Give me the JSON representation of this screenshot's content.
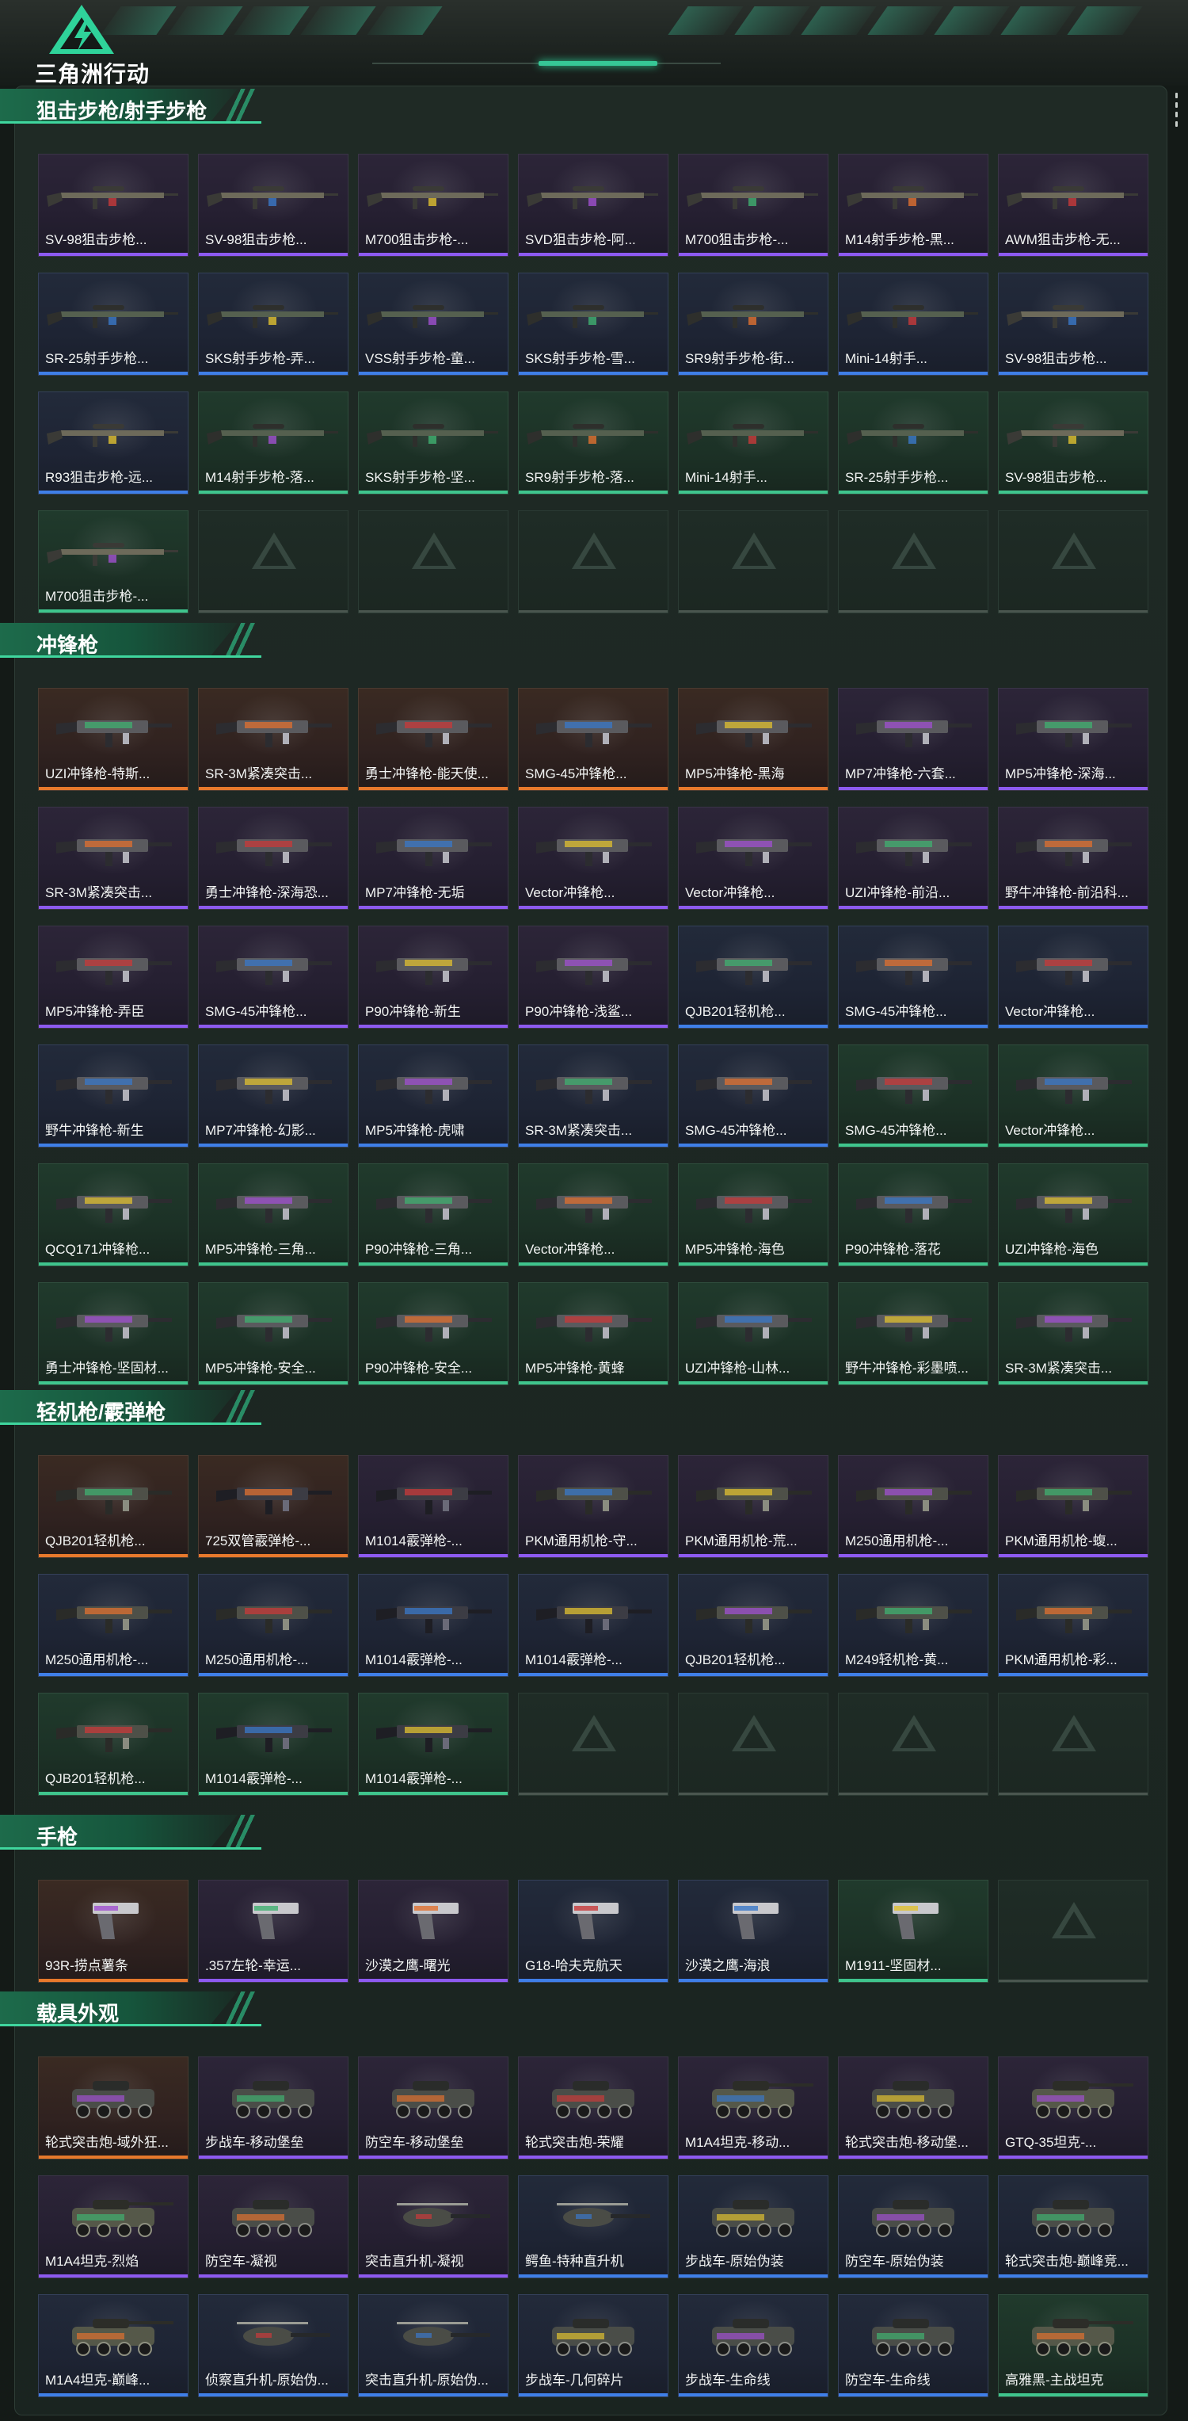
{
  "app": {
    "logo_text": "三角洲行动"
  },
  "colors": {
    "accent": "#3fd69e",
    "rarity_purple": "#8d5af0",
    "rarity_orange": "#e8792c",
    "rarity_blue": "#3f7fe8",
    "rarity_green": "#3fc58d"
  },
  "sections": [
    {
      "title": "狙击步枪/射手步枪",
      "items": [
        {
          "name": "SV-98狙击步枪...",
          "rarity": "purple",
          "kind": "sniper"
        },
        {
          "name": "SV-98狙击步枪...",
          "rarity": "purple",
          "kind": "sniper"
        },
        {
          "name": "M700狙击步枪-...",
          "rarity": "purple",
          "kind": "sniper"
        },
        {
          "name": "SVD狙击步枪-阿...",
          "rarity": "purple",
          "kind": "sniper"
        },
        {
          "name": "M700狙击步枪-...",
          "rarity": "purple",
          "kind": "sniper"
        },
        {
          "name": "M14射手步枪-黑...",
          "rarity": "purple",
          "kind": "sniper"
        },
        {
          "name": "AWM狙击步枪-无...",
          "rarity": "purple",
          "kind": "sniper"
        },
        {
          "name": "SR-25射手步枪...",
          "rarity": "blue",
          "kind": "rifle"
        },
        {
          "name": "SKS射手步枪-弄...",
          "rarity": "blue",
          "kind": "rifle"
        },
        {
          "name": "VSS射手步枪-童...",
          "rarity": "blue",
          "kind": "rifle"
        },
        {
          "name": "SKS射手步枪-雪...",
          "rarity": "blue",
          "kind": "rifle"
        },
        {
          "name": "SR9射手步枪-街...",
          "rarity": "blue",
          "kind": "rifle"
        },
        {
          "name": "Mini-14射手...",
          "rarity": "blue",
          "kind": "rifle"
        },
        {
          "name": "SV-98狙击步枪...",
          "rarity": "blue",
          "kind": "sniper"
        },
        {
          "name": "R93狙击步枪-远...",
          "rarity": "blue",
          "kind": "sniper"
        },
        {
          "name": "M14射手步枪-落...",
          "rarity": "green",
          "kind": "rifle"
        },
        {
          "name": "SKS射手步枪-坚...",
          "rarity": "green",
          "kind": "rifle"
        },
        {
          "name": "SR9射手步枪-落...",
          "rarity": "green",
          "kind": "rifle"
        },
        {
          "name": "Mini-14射手...",
          "rarity": "green",
          "kind": "rifle"
        },
        {
          "name": "SR-25射手步枪...",
          "rarity": "green",
          "kind": "rifle"
        },
        {
          "name": "SV-98狙击步枪...",
          "rarity": "green",
          "kind": "sniper"
        },
        {
          "name": "M700狙击步枪-...",
          "rarity": "green",
          "kind": "sniper"
        },
        {
          "name": "",
          "rarity": "empty"
        },
        {
          "name": "",
          "rarity": "empty"
        },
        {
          "name": "",
          "rarity": "empty"
        },
        {
          "name": "",
          "rarity": "empty"
        },
        {
          "name": "",
          "rarity": "empty"
        },
        {
          "name": "",
          "rarity": "empty"
        }
      ]
    },
    {
      "title": "冲锋枪",
      "items": [
        {
          "name": "UZI冲锋枪-特斯...",
          "rarity": "orange",
          "kind": "smg"
        },
        {
          "name": "SR-3M紧凑突击...",
          "rarity": "orange",
          "kind": "smg"
        },
        {
          "name": "勇士冲锋枪-能天使...",
          "rarity": "orange",
          "kind": "smg"
        },
        {
          "name": "SMG-45冲锋枪...",
          "rarity": "orange",
          "kind": "smg"
        },
        {
          "name": "MP5冲锋枪-黑海",
          "rarity": "orange",
          "kind": "smg"
        },
        {
          "name": "MP7冲锋枪-六套...",
          "rarity": "purple",
          "kind": "smg"
        },
        {
          "name": "MP5冲锋枪-深海...",
          "rarity": "purple",
          "kind": "smg"
        },
        {
          "name": "SR-3M紧凑突击...",
          "rarity": "purple",
          "kind": "smg"
        },
        {
          "name": "勇士冲锋枪-深海恐...",
          "rarity": "purple",
          "kind": "smg"
        },
        {
          "name": "MP7冲锋枪-无垢",
          "rarity": "purple",
          "kind": "smg"
        },
        {
          "name": "Vector冲锋枪...",
          "rarity": "purple",
          "kind": "smg"
        },
        {
          "name": "Vector冲锋枪...",
          "rarity": "purple",
          "kind": "smg"
        },
        {
          "name": "UZI冲锋枪-前沿...",
          "rarity": "purple",
          "kind": "smg"
        },
        {
          "name": "野牛冲锋枪-前沿科...",
          "rarity": "purple",
          "kind": "smg"
        },
        {
          "name": "MP5冲锋枪-弄臣",
          "rarity": "purple",
          "kind": "smg"
        },
        {
          "name": "SMG-45冲锋枪...",
          "rarity": "purple",
          "kind": "smg"
        },
        {
          "name": "P90冲锋枪-新生",
          "rarity": "purple",
          "kind": "smg"
        },
        {
          "name": "P90冲锋枪-浅鲨...",
          "rarity": "purple",
          "kind": "smg"
        },
        {
          "name": "QJB201轻机枪...",
          "rarity": "blue",
          "kind": "smg"
        },
        {
          "name": "SMG-45冲锋枪...",
          "rarity": "blue",
          "kind": "smg"
        },
        {
          "name": "Vector冲锋枪...",
          "rarity": "blue",
          "kind": "smg"
        },
        {
          "name": "野牛冲锋枪-新生",
          "rarity": "blue",
          "kind": "smg"
        },
        {
          "name": "MP7冲锋枪-幻影...",
          "rarity": "blue",
          "kind": "smg"
        },
        {
          "name": "MP5冲锋枪-虎啸",
          "rarity": "blue",
          "kind": "smg"
        },
        {
          "name": "SR-3M紧凑突击...",
          "rarity": "blue",
          "kind": "smg"
        },
        {
          "name": "SMG-45冲锋枪...",
          "rarity": "blue",
          "kind": "smg"
        },
        {
          "name": "SMG-45冲锋枪...",
          "rarity": "green",
          "kind": "smg"
        },
        {
          "name": "Vector冲锋枪...",
          "rarity": "green",
          "kind": "smg"
        },
        {
          "name": "QCQ171冲锋枪...",
          "rarity": "green",
          "kind": "smg"
        },
        {
          "name": "MP5冲锋枪-三角...",
          "rarity": "green",
          "kind": "smg"
        },
        {
          "name": "P90冲锋枪-三角...",
          "rarity": "green",
          "kind": "smg"
        },
        {
          "name": "Vector冲锋枪...",
          "rarity": "green",
          "kind": "smg"
        },
        {
          "name": "MP5冲锋枪-海色",
          "rarity": "green",
          "kind": "smg"
        },
        {
          "name": "P90冲锋枪-落花",
          "rarity": "green",
          "kind": "smg"
        },
        {
          "name": "UZI冲锋枪-海色",
          "rarity": "green",
          "kind": "smg"
        },
        {
          "name": "勇士冲锋枪-坚固材...",
          "rarity": "green",
          "kind": "smg"
        },
        {
          "name": "MP5冲锋枪-安全...",
          "rarity": "green",
          "kind": "smg"
        },
        {
          "name": "P90冲锋枪-安全...",
          "rarity": "green",
          "kind": "smg"
        },
        {
          "name": "MP5冲锋枪-黄蜂",
          "rarity": "green",
          "kind": "smg"
        },
        {
          "name": "UZI冲锋枪-山林...",
          "rarity": "green",
          "kind": "smg"
        },
        {
          "name": "野牛冲锋枪-彩墨喷...",
          "rarity": "green",
          "kind": "smg"
        },
        {
          "name": "SR-3M紧凑突击...",
          "rarity": "green",
          "kind": "smg"
        }
      ]
    },
    {
      "title": "轻机枪/霰弹枪",
      "items": [
        {
          "name": "QJB201轻机枪...",
          "rarity": "orange",
          "kind": "lmg"
        },
        {
          "name": "725双管霰弹枪-...",
          "rarity": "orange",
          "kind": "shotgun"
        },
        {
          "name": "M1014霰弹枪-...",
          "rarity": "purple",
          "kind": "shotgun"
        },
        {
          "name": "PKM通用机枪-守...",
          "rarity": "purple",
          "kind": "lmg"
        },
        {
          "name": "PKM通用机枪-荒...",
          "rarity": "purple",
          "kind": "lmg"
        },
        {
          "name": "M250通用机枪-...",
          "rarity": "purple",
          "kind": "lmg"
        },
        {
          "name": "PKM通用机枪-蝮...",
          "rarity": "purple",
          "kind": "lmg"
        },
        {
          "name": "M250通用机枪-...",
          "rarity": "blue",
          "kind": "lmg"
        },
        {
          "name": "M250通用机枪-...",
          "rarity": "blue",
          "kind": "lmg"
        },
        {
          "name": "M1014霰弹枪-...",
          "rarity": "blue",
          "kind": "shotgun"
        },
        {
          "name": "M1014霰弹枪-...",
          "rarity": "blue",
          "kind": "shotgun"
        },
        {
          "name": "QJB201轻机枪...",
          "rarity": "blue",
          "kind": "lmg"
        },
        {
          "name": "M249轻机枪-黄...",
          "rarity": "blue",
          "kind": "lmg"
        },
        {
          "name": "PKM通用机枪-彩...",
          "rarity": "blue",
          "kind": "lmg"
        },
        {
          "name": "QJB201轻机枪...",
          "rarity": "green",
          "kind": "lmg"
        },
        {
          "name": "M1014霰弹枪-...",
          "rarity": "green",
          "kind": "shotgun"
        },
        {
          "name": "M1014霰弹枪-...",
          "rarity": "green",
          "kind": "shotgun"
        },
        {
          "name": "",
          "rarity": "empty"
        },
        {
          "name": "",
          "rarity": "empty"
        },
        {
          "name": "",
          "rarity": "empty"
        },
        {
          "name": "",
          "rarity": "empty"
        }
      ]
    },
    {
      "title": "手枪",
      "items": [
        {
          "name": "93R-捞点薯条",
          "rarity": "orange",
          "kind": "pistol"
        },
        {
          "name": ".357左轮-幸运...",
          "rarity": "purple",
          "kind": "pistol"
        },
        {
          "name": "沙漠之鹰-曙光",
          "rarity": "purple",
          "kind": "pistol"
        },
        {
          "name": "G18-哈夫克航天",
          "rarity": "blue",
          "kind": "pistol"
        },
        {
          "name": "沙漠之鹰-海浪",
          "rarity": "blue",
          "kind": "pistol"
        },
        {
          "name": "M1911-坚固材...",
          "rarity": "green",
          "kind": "pistol"
        },
        {
          "name": "",
          "rarity": "empty"
        }
      ]
    },
    {
      "title": "载具外观",
      "items": [
        {
          "name": "轮式突击炮-域外狂...",
          "rarity": "orange",
          "kind": "vehicle"
        },
        {
          "name": "步战车-移动堡垒",
          "rarity": "purple",
          "kind": "vehicle"
        },
        {
          "name": "防空车-移动堡垒",
          "rarity": "purple",
          "kind": "vehicle"
        },
        {
          "name": "轮式突击炮-荣耀",
          "rarity": "purple",
          "kind": "vehicle"
        },
        {
          "name": "M1A4坦克-移动...",
          "rarity": "purple",
          "kind": "tank"
        },
        {
          "name": "轮式突击炮-移动堡...",
          "rarity": "purple",
          "kind": "vehicle"
        },
        {
          "name": "GTQ-35坦克-...",
          "rarity": "purple",
          "kind": "tank"
        },
        {
          "name": "M1A4坦克-烈焰",
          "rarity": "purple",
          "kind": "tank"
        },
        {
          "name": "防空车-凝视",
          "rarity": "purple",
          "kind": "vehicle"
        },
        {
          "name": "突击直升机-凝视",
          "rarity": "purple",
          "kind": "heli"
        },
        {
          "name": "鳄鱼-特种直升机",
          "rarity": "blue",
          "kind": "heli"
        },
        {
          "name": "步战车-原始伪装",
          "rarity": "blue",
          "kind": "vehicle"
        },
        {
          "name": "防空车-原始伪装",
          "rarity": "blue",
          "kind": "vehicle"
        },
        {
          "name": "轮式突击炮-巅峰竞...",
          "rarity": "blue",
          "kind": "vehicle"
        },
        {
          "name": "M1A4坦克-巅峰...",
          "rarity": "blue",
          "kind": "tank"
        },
        {
          "name": "侦察直升机-原始伪...",
          "rarity": "blue",
          "kind": "heli"
        },
        {
          "name": "突击直升机-原始伪...",
          "rarity": "blue",
          "kind": "heli"
        },
        {
          "name": "步战车-几何碎片",
          "rarity": "blue",
          "kind": "vehicle"
        },
        {
          "name": "步战车-生命线",
          "rarity": "blue",
          "kind": "vehicle"
        },
        {
          "name": "防空车-生命线",
          "rarity": "blue",
          "kind": "vehicle"
        },
        {
          "name": "高雅黑-主战坦克",
          "rarity": "green",
          "kind": "tank"
        }
      ]
    }
  ]
}
